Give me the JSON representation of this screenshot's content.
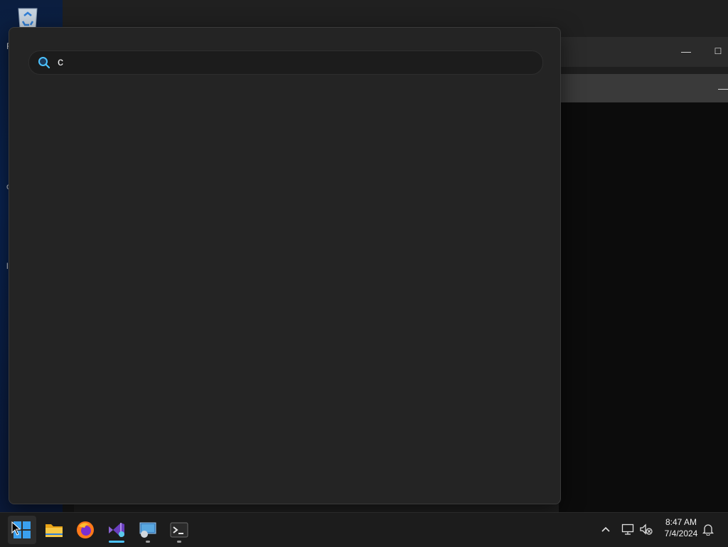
{
  "desktop": {
    "labels": [
      "F",
      "c",
      "l"
    ],
    "recycle_bin": "recycle-bin-icon"
  },
  "background_window": {
    "minimize_glyph": "—",
    "maximize_glyph": "☐",
    "second_minimize_glyph": "—"
  },
  "search": {
    "query": "c",
    "icon": "search-icon"
  },
  "taskbar": {
    "apps": [
      {
        "name": "start",
        "icon": "windows-logo-icon"
      },
      {
        "name": "file-explorer",
        "icon": "folder-icon"
      },
      {
        "name": "firefox",
        "icon": "firefox-icon"
      },
      {
        "name": "visual-studio",
        "icon": "visual-studio-icon"
      },
      {
        "name": "remote-desktop",
        "icon": "remote-desktop-icon"
      },
      {
        "name": "terminal",
        "icon": "terminal-icon"
      }
    ],
    "tray": {
      "chevron": "chevron-up-icon",
      "network": "network-icon",
      "volume": "volume-muted-icon",
      "notifications": "bell-icon"
    },
    "clock": {
      "time": "8:47 AM",
      "date": "7/4/2024"
    }
  },
  "colors": {
    "accent": "#4cc2ff",
    "flyout_bg": "#242424",
    "taskbar_bg": "#1c1c1c"
  }
}
